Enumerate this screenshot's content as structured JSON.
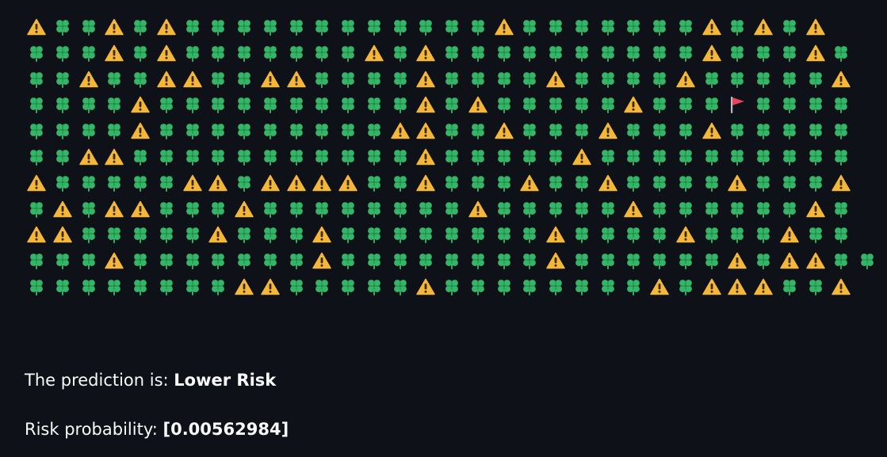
{
  "grid": {
    "icon_names": {
      "C": "four-leaf-clover-icon",
      "W": "warning-icon",
      "F": "red-flag-icon"
    },
    "colors": {
      "clover": "#35b667",
      "clover_dark": "#1f8a4c",
      "warning": "#f4b73a",
      "warning_mark": "#3a2a0c",
      "flag": "#e8445f",
      "pole": "#b8bcc4"
    },
    "rows": [
      "WCCWCWCCCCCCCCCCCCWCCCCCCCWCWCW",
      "CCCWCWCCCCCCCWCWCCCCCCCCCCWCCCWC",
      "CCWCCWWCCWWCCCCWCCCCWCCCCWCCCCCW",
      "CCCCWCCCCCCCCCCWCWCCCCCWCCCFCCCC",
      "CCCCWCCCCCCCCCWWCCWCCCWCCCWCCCCC",
      "CCWWCCCCCCCCCCCWCCCCCWCCCCCCCCCC",
      "WCCCCCWWCWWWWCCWCCCWCCWCCCCWCCCW",
      "CWCWWCCCWCCCCCCCCWCCCCCWCCCCCCWC",
      "WWCCCCCWCCCWCCCCCCCCWCCCCWCCCWCC",
      "CCCWCCCCCCCWCCCCCCCCWCCCCCCWCWWCC",
      "CCCCCCCCWWCCCCCWCCCCCCCCWCWWWCCW"
    ]
  },
  "prediction": {
    "label": "The prediction is: ",
    "value": "Lower Risk"
  },
  "probability": {
    "label": "Risk probability: ",
    "value": "[0.00562984]"
  }
}
